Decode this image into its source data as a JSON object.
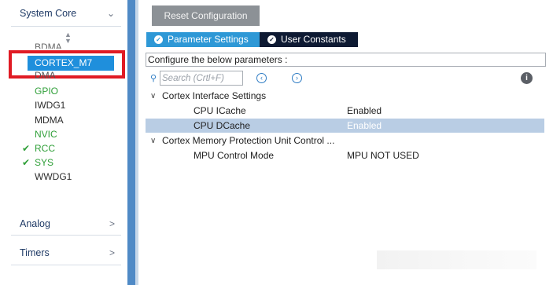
{
  "sidebar": {
    "categories": {
      "system_core": "System Core",
      "analog": "Analog",
      "timers": "Timers"
    },
    "items": {
      "bdma": "BDMA",
      "cortex": "CORTEX_M7",
      "dma": "DMA",
      "gpio": "GPIO",
      "iwdg1": "IWDG1",
      "mdma": "MDMA",
      "nvic": "NVIC",
      "rcc": "RCC",
      "sys": "SYS",
      "wwdg1": "WWDG1"
    },
    "enabled_color": "#2f9f38",
    "selected_color": "#1f8fdc",
    "highlight_color": "#e01b24"
  },
  "toolbar": {
    "reset_label": "Reset Configuration"
  },
  "tabs": [
    {
      "label": "Parameter Settings",
      "active": true
    },
    {
      "label": "User Constants",
      "active": false
    }
  ],
  "config": {
    "hint": "Configure the below parameters :",
    "search_placeholder": "Search (Crtl+F)"
  },
  "tree": {
    "group1": {
      "label": "Cortex Interface Settings",
      "rows": [
        {
          "name": "CPU ICache",
          "value": "Enabled"
        },
        {
          "name": "CPU DCache",
          "value": "Enabled",
          "selected": true
        }
      ]
    },
    "group2": {
      "label": "Cortex Memory Protection Unit Control ...",
      "rows": [
        {
          "name": "MPU Control Mode",
          "value": "MPU NOT USED"
        }
      ]
    }
  }
}
